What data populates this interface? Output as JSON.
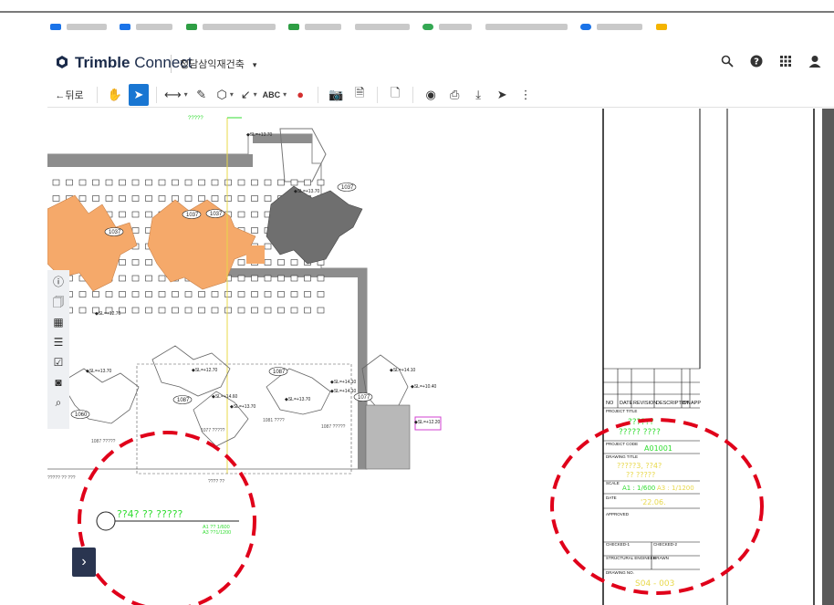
{
  "app": {
    "brand_bold": "Trimble",
    "brand_light": " Connect",
    "project_name": "청담삼익재건축",
    "project_caret": "▾"
  },
  "toolbar": {
    "back_label": "←뒤로"
  },
  "drawing": {
    "top_dim_text": "?????",
    "title_text": "??4?  ??  ?????",
    "scale_line_1": "A1  ?? 1/600",
    "scale_line_2": "A3 ??1/1200",
    "room_labels": [
      "1037",
      "1037",
      "1037",
      "1037",
      "1087",
      "1087",
      "1077",
      "1060"
    ],
    "level_marks": [
      "SL=+13.70",
      "SL=+13.70",
      "SL=+12.70",
      "SL=+13.70",
      "SL=+12.70",
      "SL=+14.60",
      "SL=+13.70",
      "SL=+13.70",
      "SL=+14.10",
      "SL=+14.10",
      "SL=+14.10",
      "SL=+10.40",
      "SL=+12.20"
    ],
    "small_notes": [
      "1087 ?????",
      "1077 ?????",
      "1087 ?????",
      "????? ?? ???",
      "???? ??",
      "1081 ????"
    ]
  },
  "title_block": {
    "revision_headers": [
      "NO",
      "DATE",
      "REVISION",
      "DESCRIPTION",
      "BY",
      "APP"
    ],
    "project_title_label": "PROJECT TITLE",
    "project_title_line1": "??????",
    "project_title_line2": "?????  ????",
    "project_code_label": "PROJECT CODE",
    "project_code_value": "A01001",
    "drawing_title_label": "DRAWING TITLE",
    "drawing_title_line1": "?????3, ??4?",
    "drawing_title_line2": "??  ?????",
    "scale_label": "SCALE",
    "scale_a1": "A1  : 1/600",
    "scale_a3": "A3  : 1/1200",
    "date_label": "DATE",
    "date_value": "'22.06.",
    "approved_label": "APPROVED",
    "checked1_label": "CHECKED-1",
    "checked2_label": "CHECKED-2",
    "structural_label": "STRUCTURAL ENGINEER",
    "drawn_label": "DRAWN",
    "drawing_no_label": "DRAWING NO.",
    "drawing_no_value": "S04 - 003"
  },
  "colors": {
    "accent": "#1976d2",
    "annotation_red": "#e0001a",
    "text_green": "#33dd33",
    "text_yellow": "#e8d84a",
    "building_orange": "#f5a96a",
    "building_gray": "#6f6f6f"
  }
}
